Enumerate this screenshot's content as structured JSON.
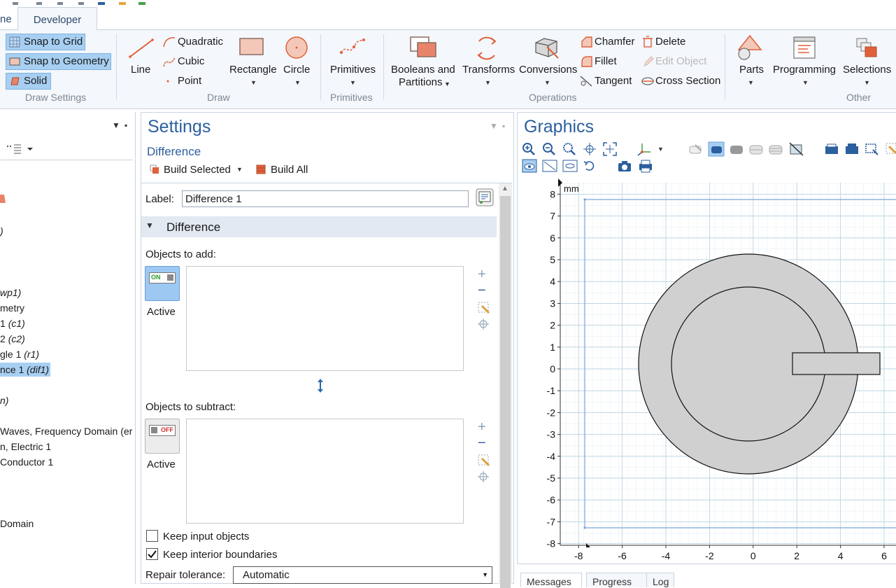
{
  "tabs": {
    "partial_home": "ne",
    "developer": "Developer"
  },
  "ribbon": {
    "draw_settings": {
      "snap_grid": "Snap to Grid",
      "snap_geometry": "Snap to Geometry",
      "solid": "Solid",
      "group": "Draw Settings"
    },
    "draw": {
      "line": "Line",
      "quadratic": "Quadratic",
      "cubic": "Cubic",
      "point": "Point",
      "rectangle": "Rectangle",
      "circle": "Circle",
      "group": "Draw"
    },
    "primitives": {
      "label": "Primitives",
      "group": "Primitives"
    },
    "operations": {
      "booleans_1": "Booleans and",
      "booleans_2": "Partitions",
      "transforms": "Transforms",
      "conversions": "Conversions",
      "chamfer": "Chamfer",
      "fillet": "Fillet",
      "tangent": "Tangent",
      "delete": "Delete",
      "edit_object": "Edit Object",
      "cross_section": "Cross Section",
      "group": "Operations"
    },
    "other": {
      "parts": "Parts",
      "programming": "Programming",
      "selections": "Selections",
      "group": "Other"
    }
  },
  "tree": {
    "items": [
      {
        "text": ")",
        "italic": true
      },
      {
        "text": "wp1)",
        "italic": true
      },
      {
        "text": "metry",
        "italic": false
      },
      {
        "text": "(c1)",
        "italic": true,
        "prefix": "1 "
      },
      {
        "text": "(c2)",
        "italic": true,
        "prefix": "2 "
      },
      {
        "text": "(r1)",
        "italic": true,
        "prefix": "gle 1 "
      },
      {
        "text": "(dif1)",
        "italic": true,
        "prefix": "nce 1 "
      },
      {
        "text": "n)",
        "italic": true
      },
      {
        "text": "Waves, Frequency Domain (er",
        "italic": false
      },
      {
        "text": "n, Electric 1",
        "italic": false
      },
      {
        "text": " Conductor 1",
        "italic": false
      },
      {
        "text": " Domain",
        "italic": false
      }
    ]
  },
  "settings": {
    "title": "Settings",
    "subtitle": "Difference",
    "build_selected": "Build Selected",
    "build_all": "Build All",
    "label_caption": "Label:",
    "label_value": "Difference 1",
    "section": "Difference",
    "objects_add": "Objects to add:",
    "objects_subtract": "Objects to subtract:",
    "toggle_on": "ON",
    "toggle_off": "OFF",
    "active_1": "Active",
    "active_2": "Active",
    "keep_input": "Keep input objects",
    "keep_interior": "Keep interior boundaries",
    "keep_input_checked": false,
    "keep_interior_checked": true,
    "repair_caption": "Repair tolerance:",
    "repair_value": "Automatic"
  },
  "graphics": {
    "title": "Graphics",
    "unit": "mm",
    "y_ticks": [
      "8",
      "7",
      "6",
      "5",
      "4",
      "3",
      "2",
      "1",
      "0",
      "-1",
      "-2",
      "-3",
      "-4",
      "-5",
      "-6",
      "-7",
      "-8"
    ],
    "x_ticks": [
      "-8",
      "-6",
      "-4",
      "-2",
      "0",
      "2",
      "4",
      "6"
    ]
  },
  "bottom_tabs": {
    "messages": "Messages",
    "progress": "Progress",
    "log": "Log"
  },
  "colors": {
    "accent": "#2c5f9e",
    "highlight": "#a7cff2",
    "geometry_fill": "#d0d0d0",
    "grid": "#cfe0ea"
  }
}
